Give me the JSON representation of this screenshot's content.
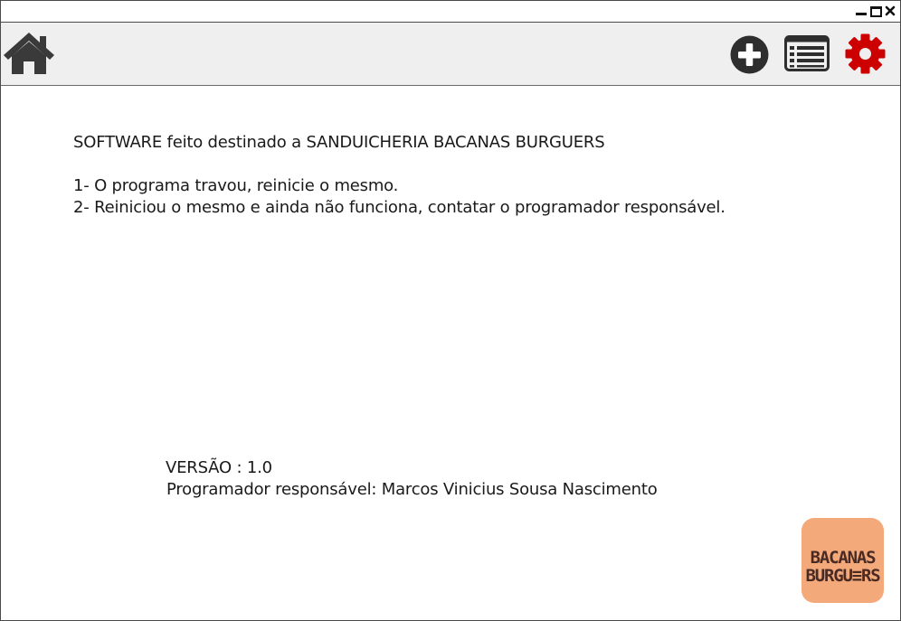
{
  "window": {
    "controls": {
      "minimize_icon": "minimize-icon",
      "maximize_icon": "maximize-icon",
      "close_icon": "close-icon"
    }
  },
  "toolbar": {
    "buttons": [
      {
        "name": "home",
        "icon": "home-icon",
        "color": "#3a3a3a"
      },
      {
        "name": "add",
        "icon": "plus-circle-icon",
        "color": "#2e2e2e"
      },
      {
        "name": "list",
        "icon": "list-icon",
        "color": "#2e2e2e"
      },
      {
        "name": "settings",
        "icon": "gear-icon",
        "color": "#cc0000"
      }
    ],
    "background": "#efefef"
  },
  "content": {
    "intro": "SOFTWARE feito destinado a SANDUICHERIA BACANAS BURGUERS",
    "steps": [
      "1- O programa travou, reinicie o mesmo.",
      "2- Reiniciou o mesmo e ainda não funciona, contatar o programador responsável."
    ],
    "version": "VERSÃO : 1.0",
    "developer": "Programador responsável: Marcos Vinicius Sousa Nascimento"
  },
  "logo": {
    "line1": "BACANAS",
    "line2": "BURGU≡RS",
    "background": "#f4a97a",
    "text_color": "#4a2b24"
  }
}
